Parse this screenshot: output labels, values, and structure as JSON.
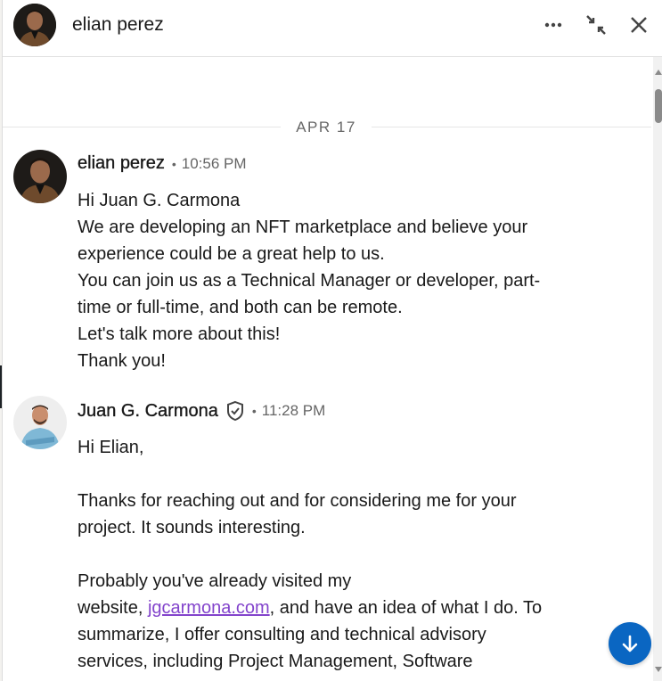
{
  "header": {
    "contact_name": "elian perez",
    "more_icon": "more-horizontal-icon",
    "collapse_icon": "collapse-icon",
    "close_icon": "close-icon"
  },
  "divider": {
    "date": "APR 17"
  },
  "messages": [
    {
      "sender": "elian perez",
      "separator": "•",
      "time": "10:56 PM",
      "lines": [
        "Hi Juan G. Carmona",
        "We are developing an NFT marketplace and believe your",
        "experience could be a great help to us.",
        "You can join us as a Technical Manager or developer, part-",
        "time or full-time, and both can be remote.",
        "Let's talk more about this!",
        "Thank you!"
      ]
    },
    {
      "sender": "Juan G. Carmona",
      "verified_icon": "verified-shield-icon",
      "separator": "•",
      "time": "11:28 PM",
      "lines": [
        "Hi Elian,",
        "",
        "Thanks for reaching out and for considering me for your",
        "project. It sounds interesting.",
        "",
        "Probably you've already visited my"
      ],
      "link_line": {
        "before": "website, ",
        "link": "jgcarmona.com",
        "after": ", and have an idea of what I do. To"
      },
      "lines_after": [
        "summarize, I offer consulting and technical advisory",
        "services, including Project Management, Software"
      ]
    }
  ],
  "jump_button": {
    "icon": "arrow-down-icon"
  },
  "colors": {
    "accent": "#0a66c2",
    "link": "#8344cc",
    "muted_text": "#666666"
  }
}
